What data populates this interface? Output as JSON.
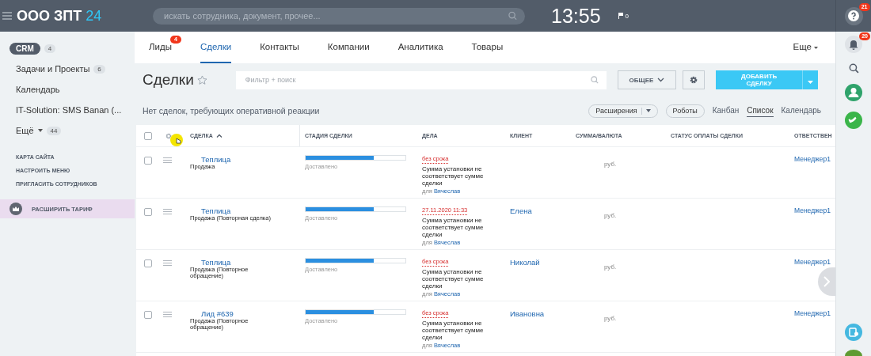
{
  "top_bar": {
    "logo": "ООО ЗПТ",
    "logo_accent": "24",
    "search": {
      "placeholder": "искать сотрудника, документ, прочее..."
    },
    "clock": "13:55",
    "flags": "0",
    "help_badge": "21"
  },
  "sidebar": {
    "items": [
      {
        "label": "CRM",
        "count": "4",
        "selected": true
      },
      {
        "label": "Задачи и Проекты",
        "count": "6",
        "selected": false
      },
      {
        "label": "Календарь",
        "selected": false
      },
      {
        "label": "IT-Solution: SMS Banan (...",
        "selected": false
      }
    ],
    "more": {
      "label": "Ещё",
      "count": "44"
    },
    "links": [
      "КАРТА САЙТА",
      "НАСТРОИТЬ МЕНЮ",
      "ПРИГЛАСИТЬ СОТРУДНИКОВ"
    ],
    "upgrade": "РАСШИРИТЬ ТАРИФ"
  },
  "tabs": [
    {
      "label": "Лиды",
      "badge": "4",
      "selected": false
    },
    {
      "label": "Сделки",
      "selected": true
    },
    {
      "label": "Контакты",
      "selected": false
    },
    {
      "label": "Компании",
      "selected": false
    },
    {
      "label": "Аналитика",
      "selected": false
    },
    {
      "label": "Товары",
      "selected": false
    }
  ],
  "more_tab": "Еще",
  "toolbar": {
    "title": "Сделки",
    "filter": {
      "placeholder": "Фильтр + поиск"
    },
    "preset_button": "ОБЩЕЕ",
    "add_button": "ДОБАВИТЬ СДЕЛКУ"
  },
  "notice": "Нет сделок, требующих оперативной реакции",
  "extensions_button": "Расширения",
  "robots_button": "Роботы",
  "views": [
    {
      "label": "Канбан",
      "selected": false
    },
    {
      "label": "Список",
      "selected": true
    },
    {
      "label": "Календарь",
      "selected": false
    }
  ],
  "table": {
    "select_all": {
      "checked": false
    },
    "columns": [
      "СДЕЛКА",
      "СТАДИЯ СДЕЛКИ",
      "ДЕЛА",
      "КЛИЕНТ",
      "СУММА/ВАЛЮТА",
      "СТАТУС ОПЛАТЫ СДЕЛКИ",
      "ОТВЕТСТВЕН"
    ],
    "rows": [
      {
        "checked": false,
        "title": "Теплица",
        "subtitle": "Продажа",
        "stage": "Доставлено",
        "level": 0.68,
        "due": "без срока",
        "task": "Сумма установки не соответствует сумме сделки",
        "for_label": "для",
        "for_name": "Вячеслав",
        "currency": "руб.",
        "responsible": "Менеджер1"
      },
      {
        "checked": false,
        "title": "Теплица",
        "subtitle": "Продажа (Повторная сделка)",
        "stage": "Доставлено",
        "level": 0.68,
        "due": "27.11.2020 11:33",
        "task": "Сумма установки не соответствует сумме сделки",
        "for_label": "для",
        "for_name": "Вячеслав",
        "client": "Елена",
        "currency": "руб.",
        "responsible": "Менеджер1"
      },
      {
        "checked": false,
        "title": "Теплица",
        "subtitle": "Продажа (Повторное обращение)",
        "stage": "Доставлено",
        "level": 0.68,
        "due": "без срока",
        "task": "Сумма установки не соответствует сумме сделки",
        "for_label": "для",
        "for_name": "Вячеслав",
        "client": "Николай",
        "currency": "руб.",
        "responsible": "Менеджер1"
      },
      {
        "checked": false,
        "title": "Лид #639",
        "subtitle": "Продажа (Повторное обращение)",
        "stage": "Доставлено",
        "level": 0.68,
        "due": "без срока",
        "task": "Сумма установки не соответствует сумме сделки",
        "for_label": "для",
        "for_name": "Вячеслав",
        "client": "Ивановна",
        "currency": "руб.",
        "responsible": "Менеджер1"
      }
    ]
  },
  "right_rail": {
    "notifications_badge": "20"
  }
}
